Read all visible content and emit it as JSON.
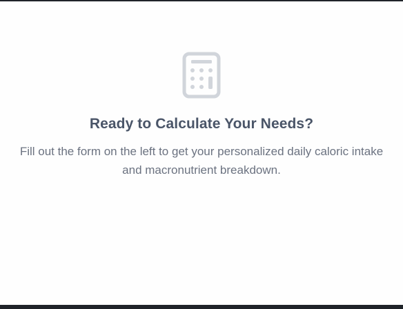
{
  "empty_state": {
    "icon": "calculator-icon",
    "title": "Ready to Calculate Your Needs?",
    "description": "Fill out the form on the left to get your personalized daily caloric intake and macronutrient breakdown."
  },
  "colors": {
    "background": "#fefefe",
    "frame": "#1f2329",
    "icon": "#d1d5db",
    "title": "#4a5568",
    "description": "#6b7280"
  }
}
